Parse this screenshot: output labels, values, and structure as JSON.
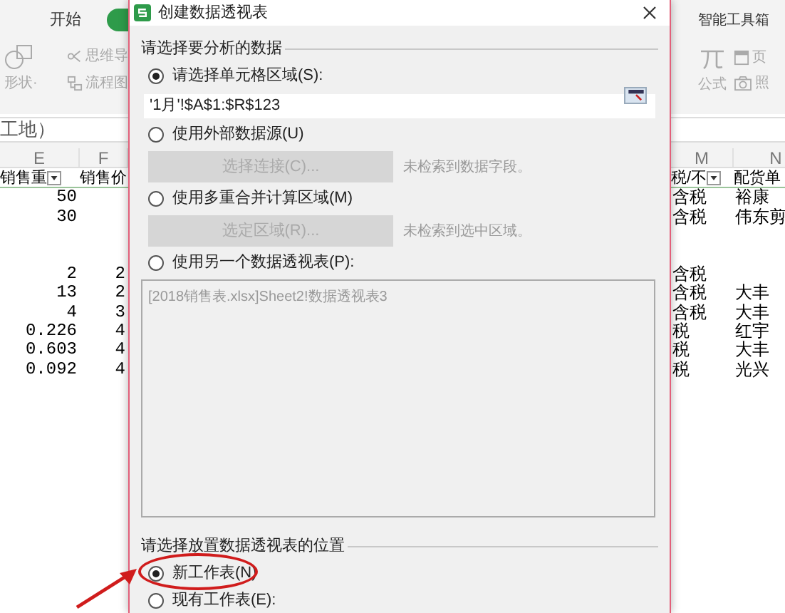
{
  "left_sheet": {
    "tabs": [
      {
        "label": "开始",
        "selected": false
      },
      {
        "selected": true
      }
    ],
    "tools": [
      {
        "kind": "shape",
        "label": "形状·"
      },
      {
        "kind": "mindmap",
        "label": "思维导"
      },
      {
        "kind": "flow",
        "label": "流程图"
      }
    ],
    "formula_bar": "工地）",
    "columns": [
      "E",
      "F"
    ],
    "header": [
      "销售重",
      "销售价"
    ],
    "rows": [
      [
        "50",
        ""
      ],
      [
        "30",
        ""
      ],
      [
        "",
        ""
      ],
      [
        "",
        ""
      ],
      [
        "2",
        "2"
      ],
      [
        "13",
        "2"
      ],
      [
        "4",
        "3"
      ],
      [
        "0.226",
        "4"
      ],
      [
        "0.603",
        "4"
      ],
      [
        "0.092",
        "4"
      ]
    ]
  },
  "dialog": {
    "title": "创建数据透视表",
    "items": [
      {
        "kind": "section",
        "label": "请选择要分析的数据"
      },
      {
        "kind": "radio",
        "label": "请选择单元格区域(S):",
        "selected": true
      },
      {
        "kind": "range_field",
        "value": "'1月'!$A$1:$R$123"
      },
      {
        "kind": "radio",
        "label": "使用外部数据源(U)",
        "selected": false
      },
      {
        "kind": "action",
        "label": "选择连接(C)...",
        "note": "未检索到数据字段。",
        "disabled": true
      },
      {
        "kind": "radio",
        "label": "使用多重合并计算区域(M)",
        "selected": false
      },
      {
        "kind": "action",
        "label": "选定区域(R)...",
        "note": "未检索到选中区域。",
        "disabled": true
      },
      {
        "kind": "radio",
        "label": "使用另一个数据透视表(P):",
        "selected": false
      },
      {
        "kind": "list_box",
        "items": [
          "[2018销售表.xlsx]Sheet2!数据透视表3"
        ],
        "disabled": true
      },
      {
        "kind": "section",
        "label": "请选择放置数据透视表的位置"
      },
      {
        "kind": "radio",
        "label": "新工作表(N)",
        "selected": true,
        "highlighted": true
      },
      {
        "kind": "radio",
        "label": "现有工作表(E):",
        "selected": false
      }
    ]
  },
  "right_sheet": {
    "ribbon_title": "智能工具箱",
    "tools": [
      {
        "kind": "pi",
        "label": "公式"
      },
      {
        "kind": "header",
        "label": "页"
      },
      {
        "kind": "camera",
        "label": "照"
      }
    ],
    "columns": [
      "M",
      "N"
    ],
    "header": [
      "税/不",
      "配货单"
    ],
    "rows": [
      [
        "含税",
        "裕康"
      ],
      [
        "含税",
        "伟东剪"
      ],
      [
        "",
        ""
      ],
      [
        "",
        ""
      ],
      [
        "含税",
        ""
      ],
      [
        "含税",
        "大丰"
      ],
      [
        "含税",
        "大丰"
      ],
      [
        "税",
        "红宇"
      ],
      [
        "税",
        "大丰"
      ],
      [
        "税",
        "光兴"
      ]
    ]
  }
}
